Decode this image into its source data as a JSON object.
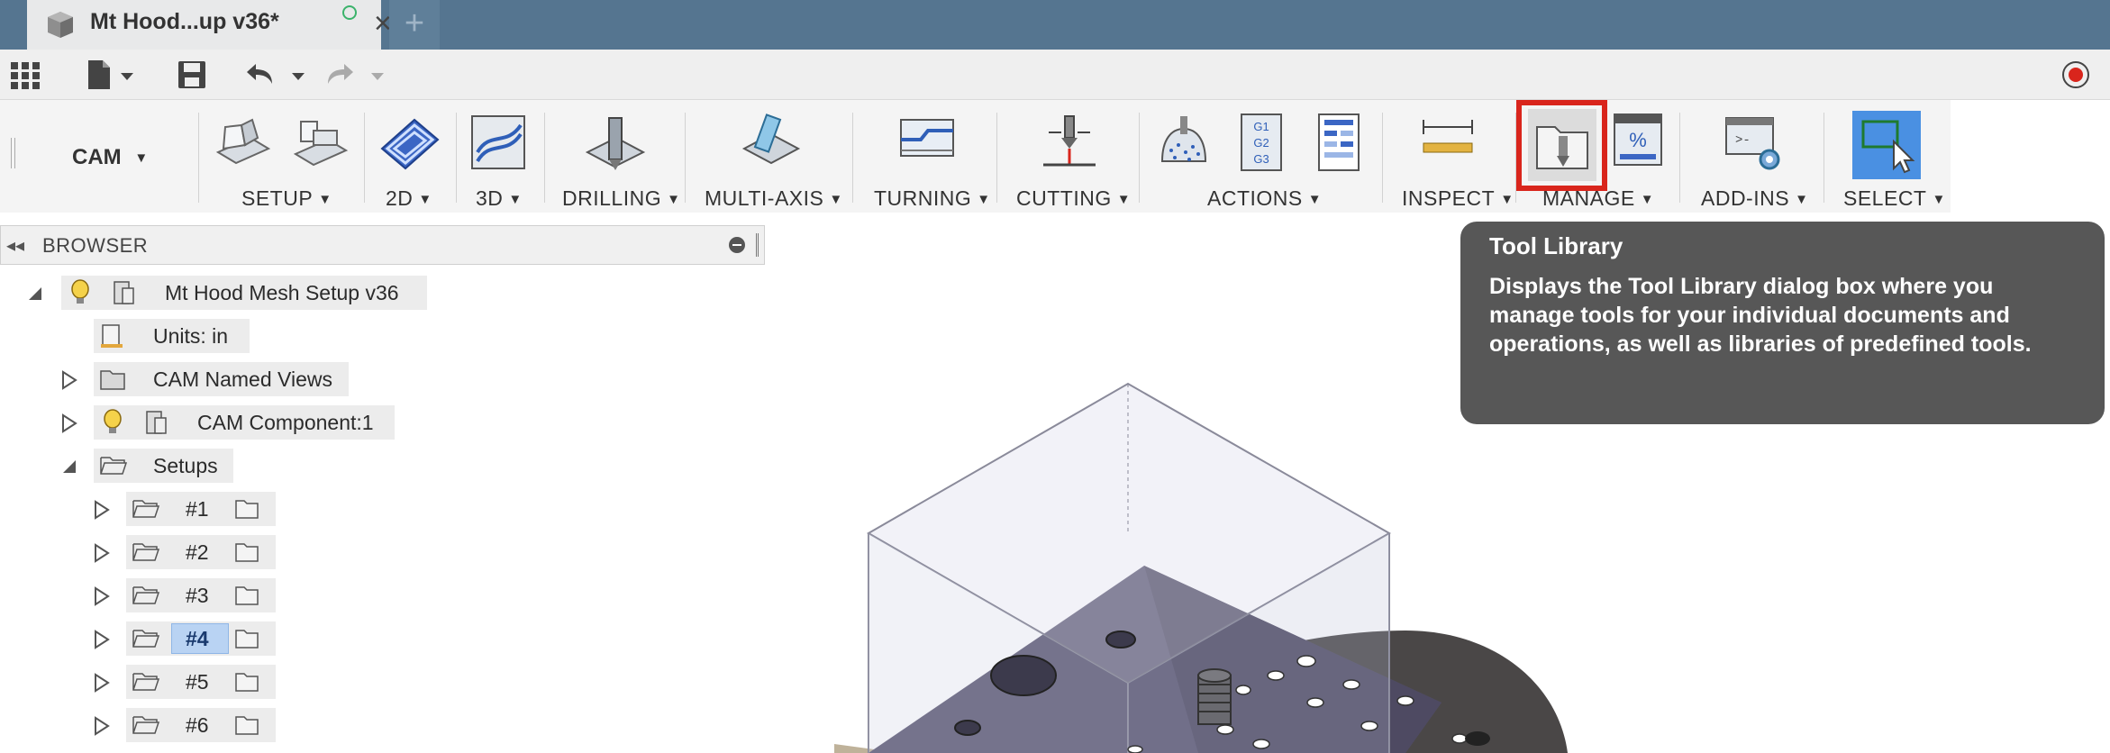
{
  "tab": {
    "title": "Mt Hood...up v36*",
    "close": "×",
    "new": "+"
  },
  "toolbar": {
    "workspace": "CAM",
    "workspace_arrow": "▼",
    "groups": [
      {
        "label": "SETUP"
      },
      {
        "label": "2D"
      },
      {
        "label": "3D"
      },
      {
        "label": "DRILLING"
      },
      {
        "label": "MULTI-AXIS"
      },
      {
        "label": "TURNING"
      },
      {
        "label": "CUTTING"
      },
      {
        "label": "ACTIONS"
      },
      {
        "label": "INSPECT"
      },
      {
        "label": "MANAGE"
      },
      {
        "label": "ADD-INS"
      },
      {
        "label": "SELECT"
      }
    ],
    "gcode_lines": [
      "G1",
      "G2",
      "G3"
    ],
    "post_symbol": "%"
  },
  "browser": {
    "collapse": "◂◂",
    "title": "BROWSER",
    "root": "Mt Hood Mesh Setup v36",
    "units": "Units: in",
    "named_views": "CAM Named Views",
    "component": "CAM Component:1",
    "setups": "Setups",
    "setup_items": [
      "#1",
      "#2",
      "#3",
      "#4",
      "#5",
      "#6"
    ],
    "selected_item": "#4"
  },
  "tooltip": {
    "title": "Tool Library",
    "body": "Displays the Tool Library dialog box where you manage tools for your individual documents and operations, as well as libraries of predefined tools."
  },
  "colors": {
    "tab_bar": "#557590",
    "highlight": "#d9251c",
    "tooltip_bg": "#575757",
    "select_blue": "#4a90e2"
  }
}
